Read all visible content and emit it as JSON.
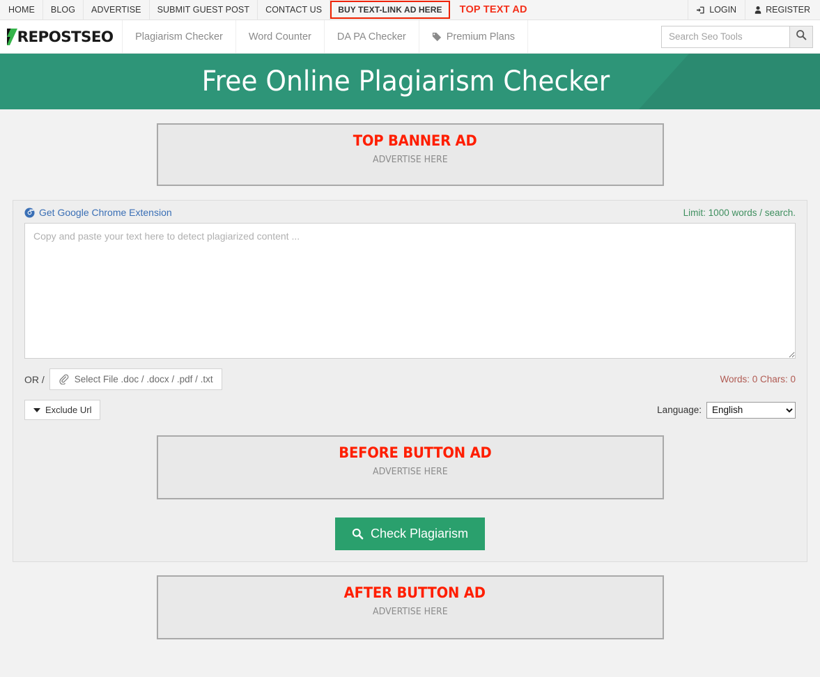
{
  "topbar": {
    "links": [
      {
        "label": "HOME",
        "highlight": false
      },
      {
        "label": "BLOG",
        "highlight": false
      },
      {
        "label": "ADVERTISE",
        "highlight": false
      },
      {
        "label": "SUBMIT GUEST POST",
        "highlight": false
      },
      {
        "label": "CONTACT US",
        "highlight": false
      },
      {
        "label": "BUY TEXT-LINK AD HERE",
        "highlight": true
      }
    ],
    "text_ad": "TOP TEXT AD",
    "login": "LOGIN",
    "register": "REGISTER",
    "highlight_color": "#ee2200",
    "text_ad_color": "#f4301a"
  },
  "navbar": {
    "logo_text": "REPOSTSEO",
    "logo_accent_color": "#35b44a",
    "items": [
      {
        "label": "Plagiarism Checker",
        "icon": ""
      },
      {
        "label": "Word Counter",
        "icon": ""
      },
      {
        "label": "DA PA Checker",
        "icon": ""
      },
      {
        "label": "Premium Plans",
        "icon": "tag-icon"
      }
    ],
    "search_placeholder": "Search Seo Tools",
    "search_value": ""
  },
  "hero": {
    "title": "Free Online Plagiarism Checker",
    "bg_color": "#2e9578",
    "accent_color": "#2b8a70"
  },
  "ads": {
    "top": {
      "title": "TOP BANNER AD",
      "subtitle": "ADVERTISE HERE"
    },
    "before_button": {
      "title": "BEFORE BUTTON AD",
      "subtitle": "ADVERTISE HERE"
    },
    "after_button": {
      "title": "AFTER BUTTON AD",
      "subtitle": "ADVERTISE HERE"
    },
    "title_color": "#ff1e00"
  },
  "tool": {
    "chrome_link": "Get Google Chrome Extension",
    "limit": "Limit: 1000 words / search.",
    "limit_color": "#3f8f5f",
    "textarea_placeholder": "Copy and paste your text here to detect plagiarized content ...",
    "textarea_value": "",
    "or_label": "OR /",
    "file_button": "Select File .doc / .docx / .pdf / .txt",
    "counter": "Words: 0 Chars: 0",
    "counter_color": "#b05a52",
    "exclude_url": "Exclude Url",
    "language_label": "Language:",
    "language_value": "English",
    "language_options": [
      "English"
    ],
    "check_button": "Check Plagiarism",
    "check_button_color": "#2aa06d"
  }
}
